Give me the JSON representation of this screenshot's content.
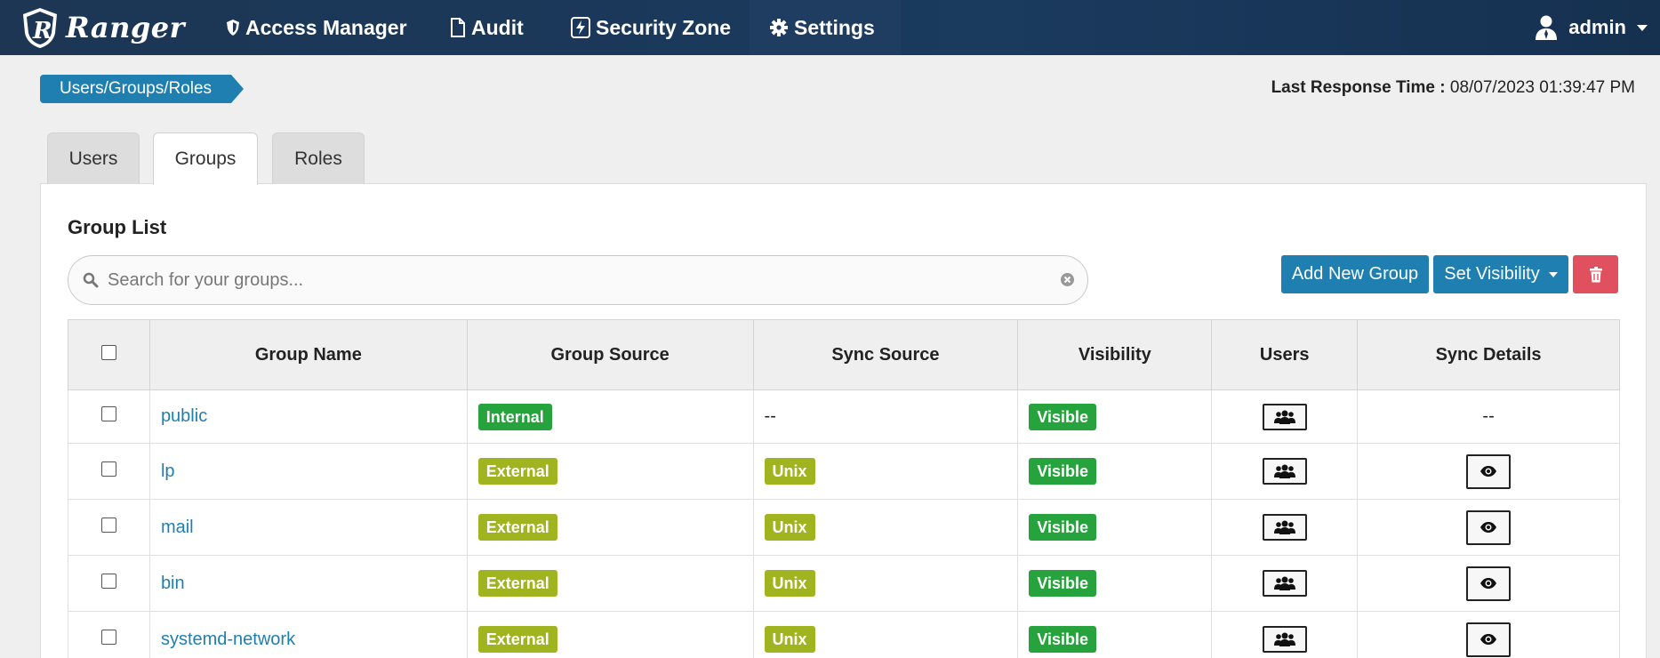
{
  "navbar": {
    "brand": "Ranger",
    "items": [
      {
        "label": "Access Manager",
        "icon": "shield-icon"
      },
      {
        "label": "Audit",
        "icon": "file-icon"
      },
      {
        "label": "Security Zone",
        "icon": "bolt-icon"
      },
      {
        "label": "Settings",
        "icon": "gear-icon"
      }
    ],
    "user": "admin"
  },
  "breadcrumb": "Users/Groups/Roles",
  "last_response": {
    "label": "Last Response Time :",
    "value": "08/07/2023 01:39:47 PM"
  },
  "tabs": [
    "Users",
    "Groups",
    "Roles"
  ],
  "active_tab": "Groups",
  "panel": {
    "title": "Group List",
    "search_placeholder": "Search for your groups...",
    "add_button": "Add New Group",
    "visibility_button": "Set Visibility"
  },
  "table": {
    "columns": [
      "Group Name",
      "Group Source",
      "Sync Source",
      "Visibility",
      "Users",
      "Sync Details"
    ],
    "rows": [
      {
        "name": "public",
        "source": "Internal",
        "sync": "--",
        "visibility": "Visible",
        "details": "--"
      },
      {
        "name": "lp",
        "source": "External",
        "sync": "Unix",
        "visibility": "Visible",
        "details": "eye"
      },
      {
        "name": "mail",
        "source": "External",
        "sync": "Unix",
        "visibility": "Visible",
        "details": "eye"
      },
      {
        "name": "bin",
        "source": "External",
        "sync": "Unix",
        "visibility": "Visible",
        "details": "eye"
      },
      {
        "name": "systemd-network",
        "source": "External",
        "sync": "Unix",
        "visibility": "Visible",
        "details": "eye"
      }
    ]
  },
  "colors": {
    "navbar": "#1c3654",
    "accent": "#1f7fb0",
    "internal": "#27a33e",
    "external": "#a0b41f",
    "delete": "#e0505f"
  }
}
